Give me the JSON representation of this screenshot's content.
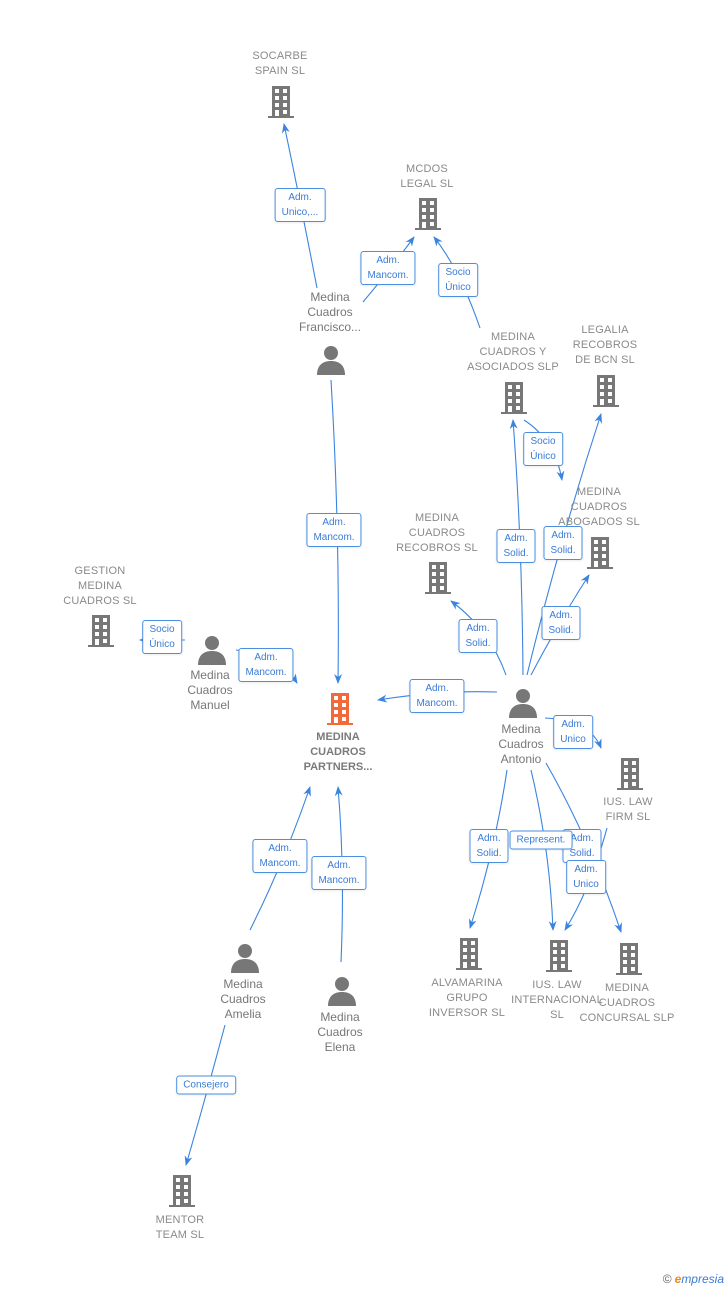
{
  "colors": {
    "edge": "#3a84e0",
    "node": "#7a7a7a",
    "focus": "#f26a3a"
  },
  "nodes": {
    "socarbe": "SOCARBE\nSPAIN  SL",
    "mcdos": "MCDOS\nLEGAL  SL",
    "francisco": "Medina\nCuadros\nFrancisco...",
    "mc_asociados": "MEDINA\nCUADROS Y\nASOCIADOS SLP",
    "legalia": "LEGALIA\nRECOBROS\nDE BCN SL",
    "mc_abogados": "MEDINA\nCUADROS\nABOGADOS SL",
    "mc_recobros": "MEDINA\nCUADROS\nRECOBROS  SL",
    "gestion": "GESTION\nMEDINA\nCUADROS  SL",
    "manuel": "Medina\nCuadros\nManuel",
    "partners": "MEDINA\nCUADROS\nPARTNERS...",
    "antonio": "Medina\nCuadros\nAntonio",
    "ius_firm": "IUS.  LAW\nFIRM  SL",
    "alvamarina": "ALVAMARINA\nGRUPO\nINVERSOR SL",
    "ius_intl": "IUS. LAW\nINTERNACIONAL\nSL",
    "concursal": "MEDINA\nCUADROS\nCONCURSAL SLP",
    "amelia": "Medina\nCuadros\nAmelia",
    "elena": "Medina\nCuadros\nElena",
    "mentor": "MENTOR\nTEAM  SL"
  },
  "edges": [
    "Adm.\nUnico,...",
    "Adm.\nMancom.",
    "Socio\nÚnico",
    "Adm.\nMancom.",
    "Socio\nÚnico",
    "Adm.\nSolid.",
    "Adm.\nSolid.",
    "Adm.\nSolid.",
    "Adm.\nSolid.",
    "Socio\nÚnico",
    "Adm.\nMancom.",
    "Adm.\nMancom.",
    "Adm.\nUnico",
    "Adm.\nSolid.",
    "Represent.",
    "Adm.\nSolid.",
    "Adm.\nUnico",
    "Adm.\nMancom.",
    "Adm.\nMancom.",
    "Consejero"
  ],
  "footer": {
    "copyright": "©",
    "brand_initial": "e",
    "brand_rest": "mpresia"
  }
}
